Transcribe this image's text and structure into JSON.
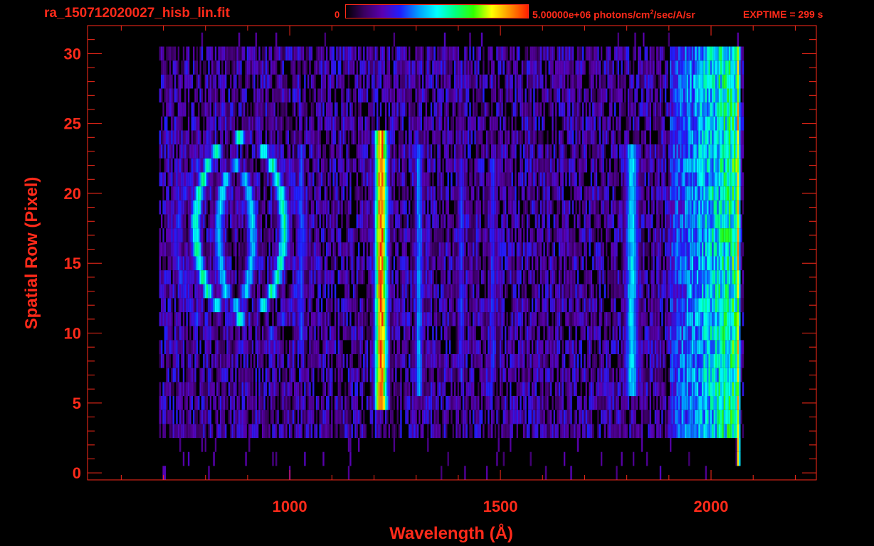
{
  "header": {
    "file_name": "ra_150712020027_hisb_lin.fit",
    "colorbar_min": "0",
    "colorbar_max_value": "5.00000e+06 photons/cm",
    "colorbar_max_exp": "2",
    "colorbar_max_unit": "/sec/A/sr",
    "exptime": "EXPTIME = 299 s"
  },
  "colors": {
    "axis": "#ff2a1a",
    "background": "#000000",
    "colormap": [
      "#000000",
      "#3a0060",
      "#5a00b0",
      "#1f1fff",
      "#00a0ff",
      "#00ffff",
      "#00ff80",
      "#30ff00",
      "#ffff00",
      "#ff9000",
      "#ff2000"
    ]
  },
  "chart_data": {
    "type": "heatmap",
    "xlabel": "Wavelength (Å)",
    "ylabel": "Spatial Row (Pixel)",
    "xlim": [
      520,
      2250
    ],
    "ylim": [
      -0.5,
      32
    ],
    "xticks": [
      1000,
      1500,
      2000
    ],
    "xtick_labels": [
      "1000",
      "1500",
      "2000"
    ],
    "yticks": [
      0,
      5,
      10,
      15,
      20,
      25,
      30
    ],
    "ytick_labels": [
      "0",
      "5",
      "10",
      "15",
      "20",
      "25",
      "30"
    ],
    "x_minor_step": 100,
    "y_minor_step": 1,
    "colorbar_range": [
      0,
      5000000
    ],
    "data_extent": {
      "x": [
        690,
        2075
      ],
      "rows_noise": [
        3,
        30
      ],
      "rows_edge": [
        0,
        31
      ]
    },
    "features": [
      {
        "kind": "ring",
        "x": 880,
        "rows": [
          11,
          24
        ],
        "half_width_x": 105,
        "level": 0.55
      },
      {
        "kind": "ring",
        "x": 870,
        "rows": [
          12,
          22
        ],
        "half_width_x": 40,
        "level": 0.45
      },
      {
        "kind": "ring",
        "x": 880,
        "rows": [
          9,
          24
        ],
        "half_width_x": 150,
        "level": 0.3
      },
      {
        "kind": "line",
        "x": 1215,
        "rows": [
          5,
          24
        ],
        "half_width_x": 18,
        "level": 1.0
      },
      {
        "kind": "line",
        "x": 1305,
        "rows": [
          6,
          23
        ],
        "half_width_x": 12,
        "level": 0.42
      },
      {
        "kind": "line",
        "x": 1025,
        "rows": [
          9,
          23
        ],
        "half_width_x": 10,
        "level": 0.35
      },
      {
        "kind": "line",
        "x": 1405,
        "rows": [
          7,
          22
        ],
        "half_width_x": 10,
        "level": 0.33
      },
      {
        "kind": "line",
        "x": 1480,
        "rows": [
          7,
          22
        ],
        "half_width_x": 10,
        "level": 0.33
      },
      {
        "kind": "line",
        "x": 1810,
        "rows": [
          6,
          23
        ],
        "half_width_x": 20,
        "level": 0.5
      },
      {
        "kind": "band",
        "x": [
          1900,
          2060
        ],
        "rows": [
          3,
          30
        ],
        "level": [
          0.3,
          0.65
        ]
      },
      {
        "kind": "line",
        "x": 2063,
        "rows": [
          1,
          30
        ],
        "half_width_x": 4,
        "level": 0.95
      }
    ]
  }
}
